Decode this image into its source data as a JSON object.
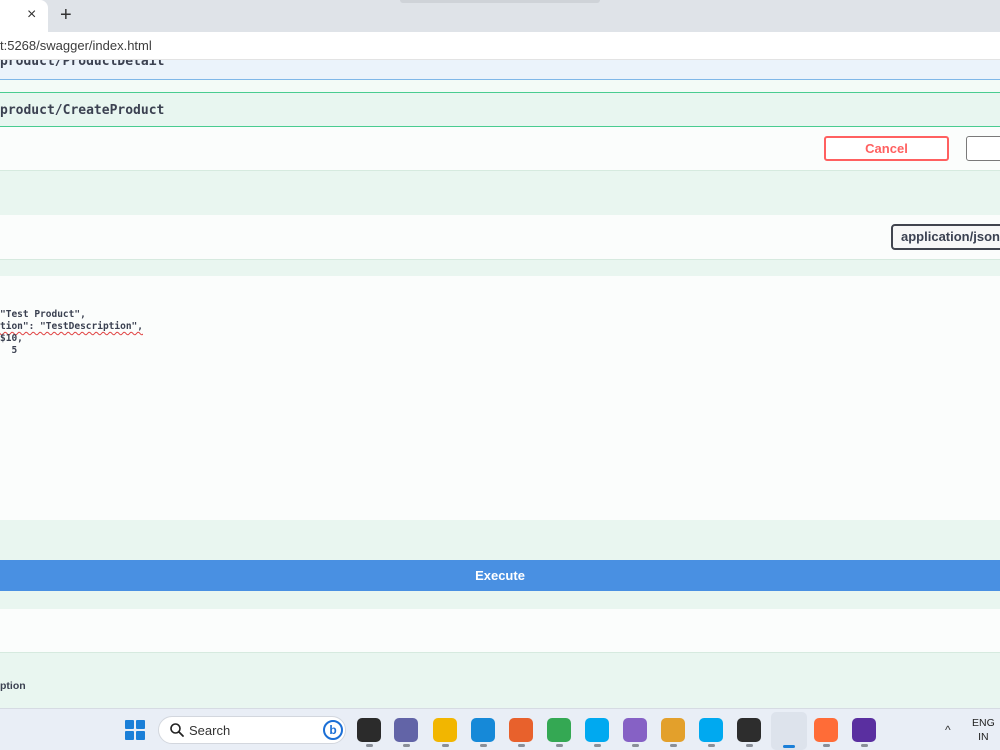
{
  "browser": {
    "tab_close": "×",
    "new_tab": "+",
    "url": "t:5268/swagger/index.html"
  },
  "swagger": {
    "prev_operation_path": "product/ProductDetail",
    "operation_path": "product/CreateProduct",
    "cancel_label": "Cancel",
    "media_type": "application/json",
    "request_body_lines": [
      "\"Test Product\",",
      "tion\": \"TestDescription\",",
      "$10,",
      "  5"
    ],
    "execute_label": "Execute",
    "description_label": "ption"
  },
  "taskbar": {
    "search_placeholder": "Search",
    "bing_letter": "b",
    "lang_top": "ENG",
    "lang_bottom": "IN",
    "apps": [
      {
        "name": "task-view",
        "color": "#2b2b2b"
      },
      {
        "name": "teams-meet",
        "color": "#6264a7"
      },
      {
        "name": "file-explorer",
        "color": "#f2b600"
      },
      {
        "name": "edge",
        "color": "#1689d8"
      },
      {
        "name": "firefox",
        "color": "#e8612c"
      },
      {
        "name": "chrome",
        "color": "#34a853"
      },
      {
        "name": "skype-1",
        "color": "#00a9f0"
      },
      {
        "name": "visual-studio",
        "color": "#8661c5"
      },
      {
        "name": "network-tool",
        "color": "#e3a02b"
      },
      {
        "name": "skype-2",
        "color": "#00a9f0"
      },
      {
        "name": "terminal",
        "color": "#2d2d2d"
      },
      {
        "name": "snipping-tool",
        "color": "#1a7fd8"
      },
      {
        "name": "postman",
        "color": "#ff6c37"
      },
      {
        "name": "media-app",
        "color": "#5a2fa0"
      }
    ]
  }
}
